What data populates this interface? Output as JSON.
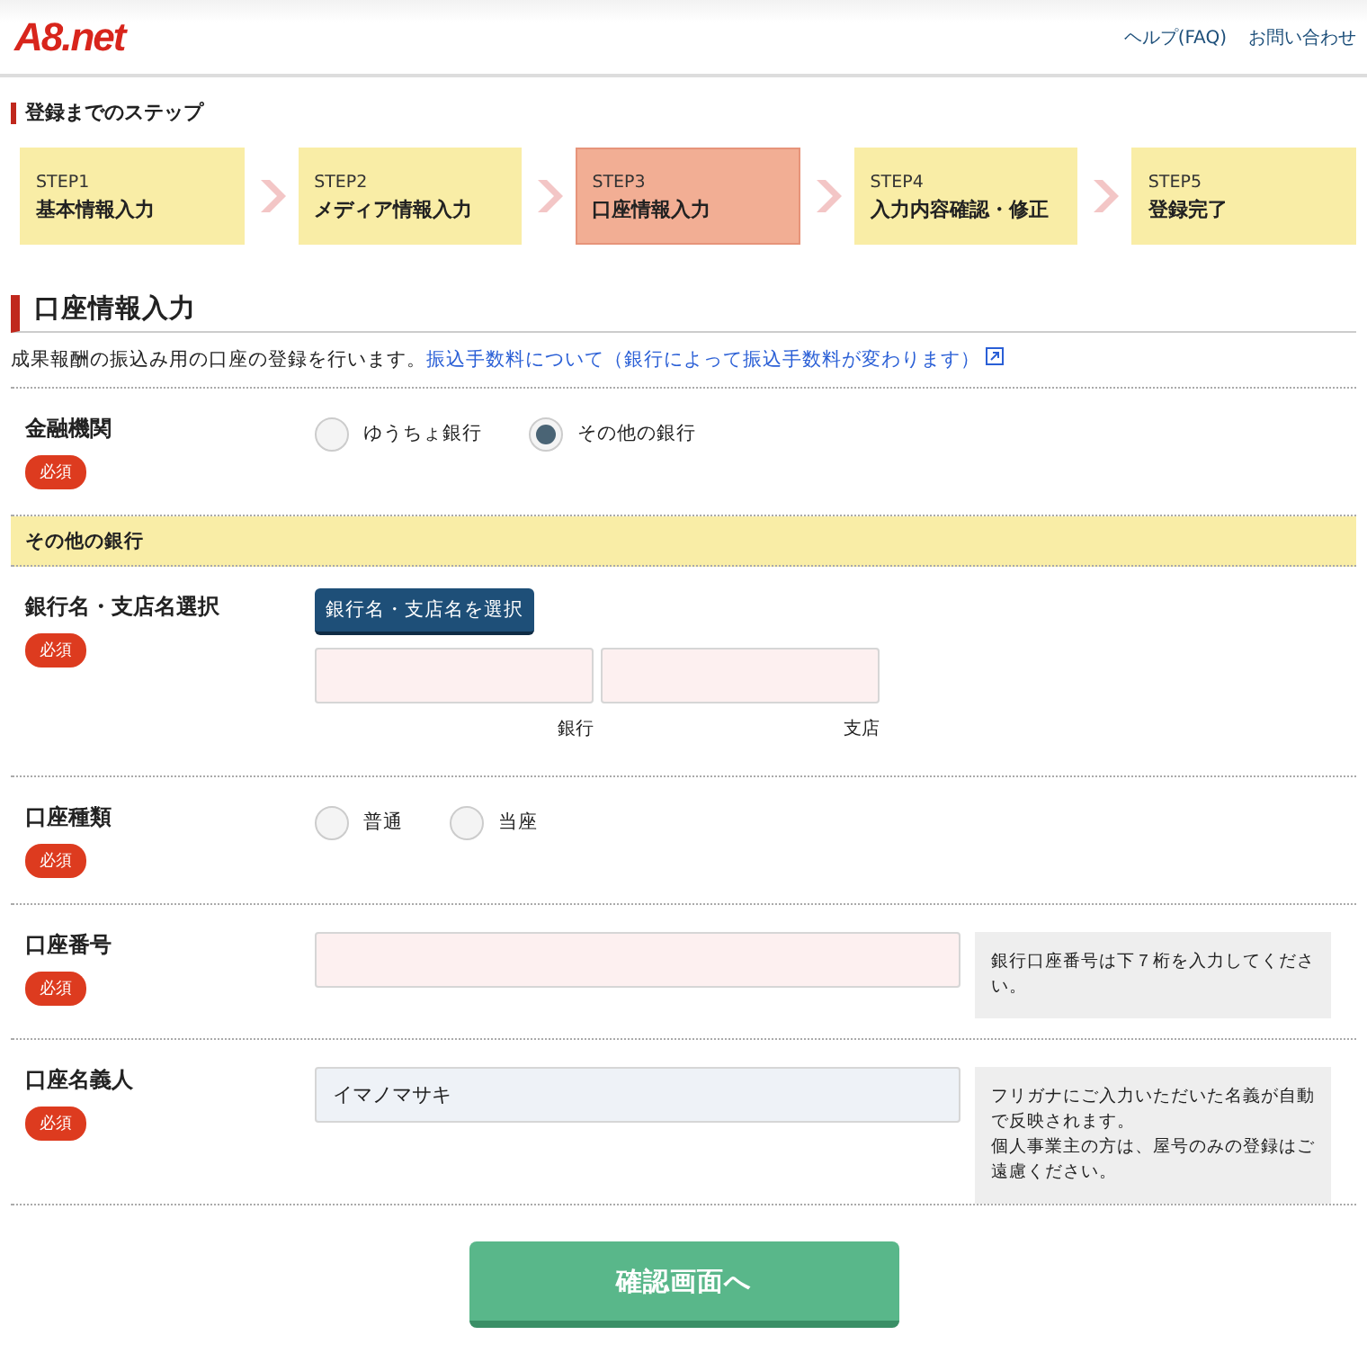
{
  "header": {
    "logo": "A8.net",
    "links": [
      "ヘルプ(FAQ)",
      "お問い合わせ"
    ]
  },
  "steps": {
    "heading": "登録までのステップ",
    "items": [
      {
        "step": "STEP1",
        "label": "基本情報入力",
        "selected": false
      },
      {
        "step": "STEP2",
        "label": "メディア情報入力",
        "selected": false
      },
      {
        "step": "STEP3",
        "label": "口座情報入力",
        "selected": true
      },
      {
        "step": "STEP4",
        "label": "入力内容確認・修正",
        "selected": false
      },
      {
        "step": "STEP5",
        "label": "登録完了",
        "selected": false
      }
    ]
  },
  "section": {
    "title": "口座情報入力",
    "description": "成果報酬の振込み用の口座の登録を行います。",
    "link": "振込手数料について（銀行によって振込手数料が変わります）"
  },
  "rows": [
    {
      "kind": "radio",
      "label": "金融機関",
      "required": "必須",
      "options": [
        {
          "label": "ゆうちょ銀行",
          "selected": false
        },
        {
          "label": "その他の銀行",
          "selected": true
        }
      ]
    },
    {
      "kind": "band",
      "label": "その他の銀行"
    },
    {
      "kind": "bank",
      "label": "銀行名・支店名選択",
      "required": "必須",
      "button": "銀行名・支店名を選択",
      "fields": [
        {
          "caption": "銀行"
        },
        {
          "caption": "支店"
        }
      ]
    },
    {
      "kind": "radio",
      "label": "口座種類",
      "required": "必須",
      "options": [
        {
          "label": "普通",
          "selected": false
        },
        {
          "label": "当座",
          "selected": false
        }
      ]
    },
    {
      "kind": "text",
      "label": "口座番号",
      "required": "必須",
      "hint": [
        "銀行口座番号は下７桁を入力してください。"
      ]
    },
    {
      "kind": "text",
      "label": "口座名義人",
      "required": "必須",
      "value": "イマノマサキ",
      "hint": [
        "フリガナにご入力いただいた名義が自動で反映されます。",
        "個人事業主の方は、屋号のみの登録はご遠慮ください。"
      ]
    }
  ],
  "submit": "確認画面へ"
}
